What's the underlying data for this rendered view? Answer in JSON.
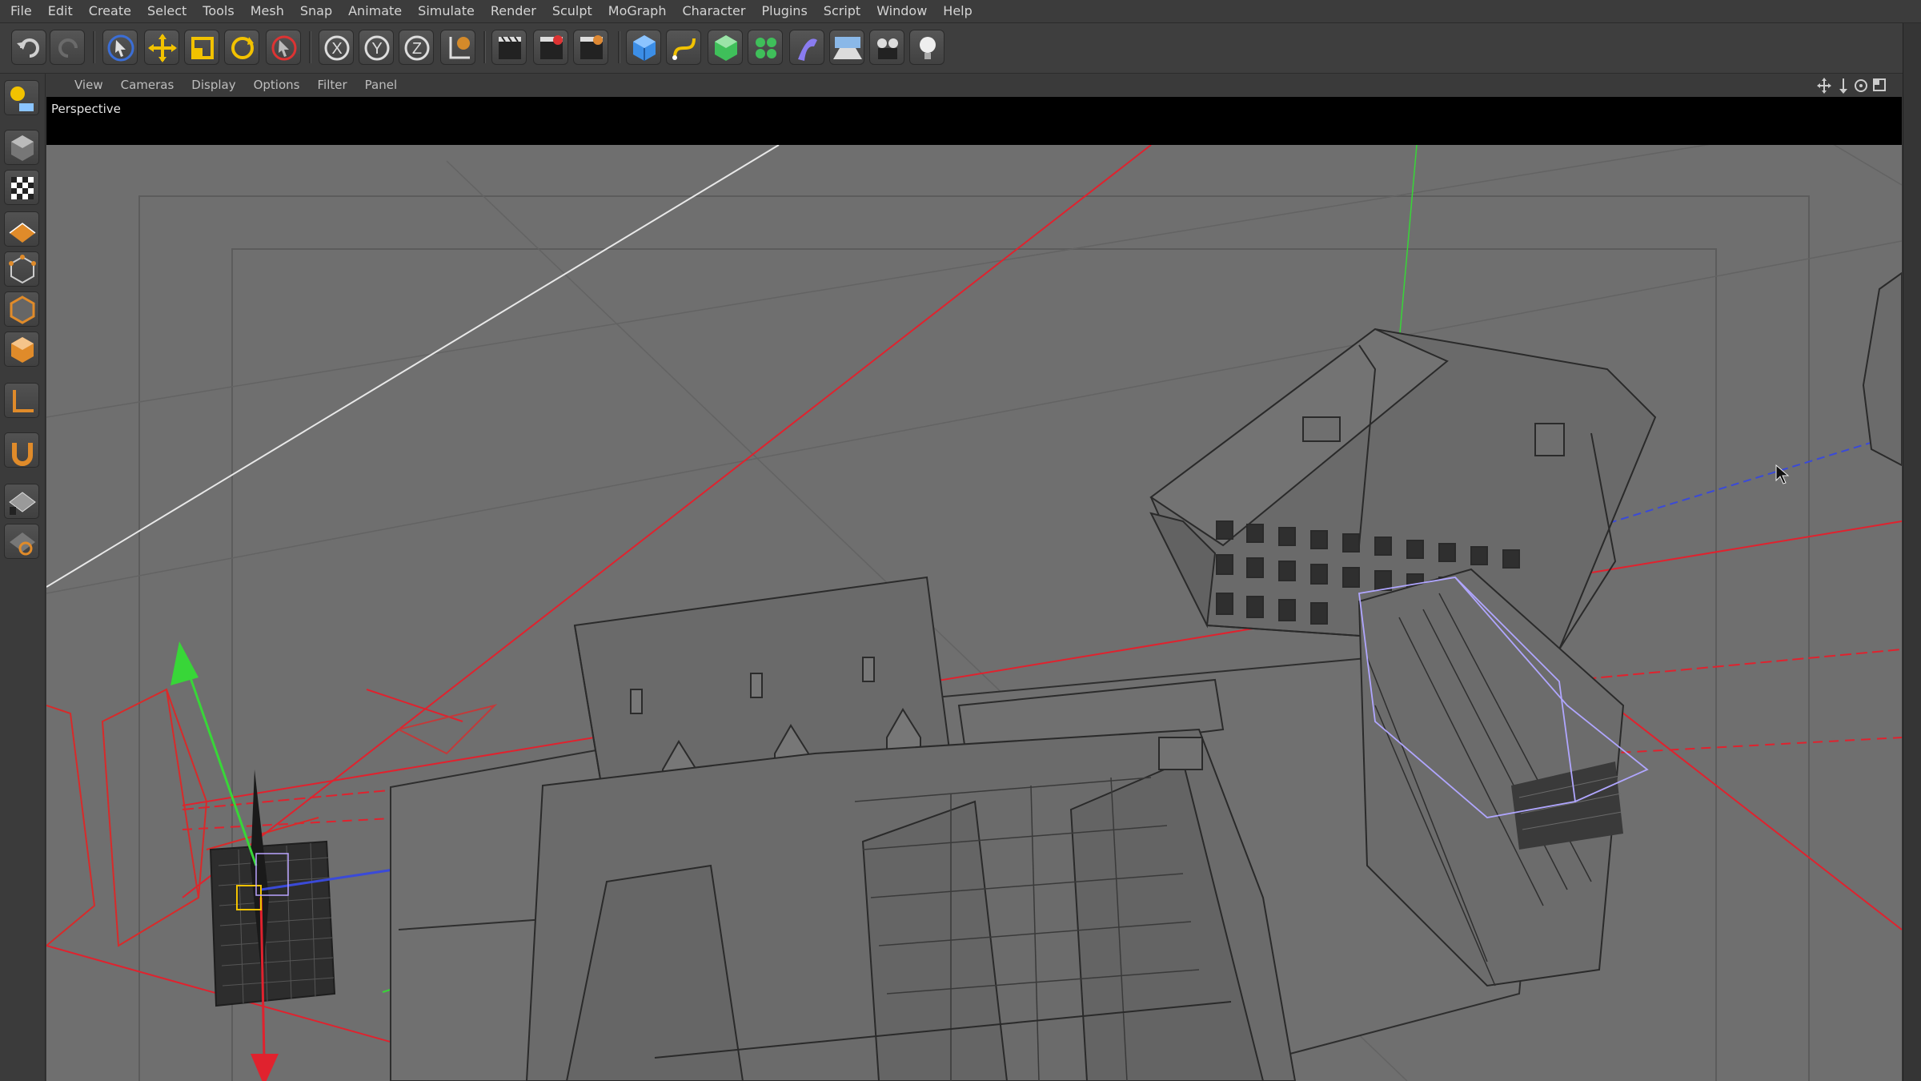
{
  "menu": [
    "File",
    "Edit",
    "Create",
    "Select",
    "Tools",
    "Mesh",
    "Snap",
    "Animate",
    "Simulate",
    "Render",
    "Sculpt",
    "MoGraph",
    "Character",
    "Plugins",
    "Script",
    "Window",
    "Help"
  ],
  "toolbar": {
    "icons": [
      "undo-icon",
      "redo-icon",
      "live-select-icon",
      "move-icon",
      "scale-icon",
      "rotate-icon",
      "last-tool-icon",
      "x-axis-lock-icon",
      "y-axis-lock-icon",
      "z-axis-lock-icon",
      "world-coordinates-icon",
      "render-view-icon",
      "render-picture-viewer-icon",
      "edit-render-settings-icon",
      "cube-object-icon",
      "spline-pen-icon",
      "subdivision-surface-icon",
      "cloner-icon",
      "deformer-icon",
      "floor-environment-icon",
      "camera-icon",
      "light-icon"
    ],
    "axis_labels": {
      "x": "X",
      "y": "Y",
      "z": "Z"
    }
  },
  "left_palette": [
    "make-editable-icon",
    "model-mode-icon",
    "texture-mode-icon",
    "workplane-mode-icon",
    "points-mode-icon",
    "edges-mode-icon",
    "polygons-mode-icon",
    "axis-mode-icon",
    "tweak-mode-icon",
    "snapping-icon",
    "locked-workplane-icon"
  ],
  "viewport": {
    "menu": [
      "View",
      "Cameras",
      "Display",
      "Options",
      "Filter",
      "Panel"
    ],
    "camera_label": "Perspective",
    "nav_icons": [
      "pan-icon",
      "zoom-icon",
      "rotate-view-icon",
      "toggle-view-icon"
    ]
  },
  "colors": {
    "background": "#6f6f6f",
    "wire": "#2e2e2e",
    "axis_x": "#e0222e",
    "axis_y": "#38d638",
    "axis_z": "#3a4ad8",
    "accent": "#3b6ed6"
  }
}
